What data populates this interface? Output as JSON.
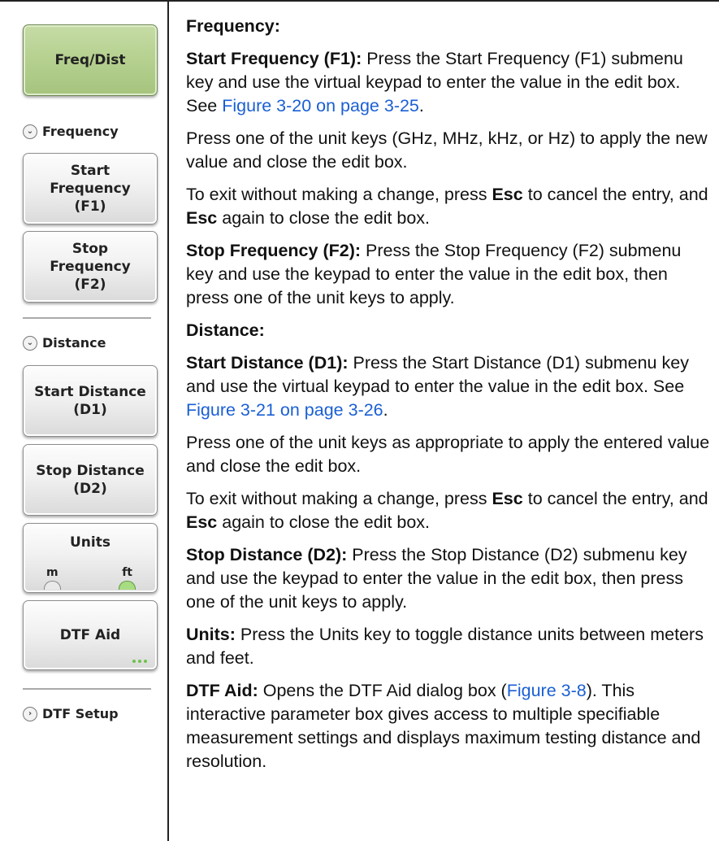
{
  "menu": {
    "freq_dist": "Freq/Dist",
    "frequency_header": "Frequency",
    "start_frequency": "Start\nFrequency\n(F1)",
    "stop_frequency": "Stop\nFrequency\n(F2)",
    "distance_header": "Distance",
    "start_distance": "Start Distance\n(D1)",
    "stop_distance": "Stop Distance\n(D2)",
    "units": {
      "label": "Units",
      "option_m": "m",
      "option_ft": "ft",
      "selected": "ft"
    },
    "dtf_aid": "DTF Aid",
    "dtf_setup_header": "DTF Setup"
  },
  "content": {
    "frequency_heading": "Frequency:",
    "start_freq_term": "Start Frequency (F1):",
    "start_freq_text": "Press the Start Frequency (F1) submenu key and use the virtual keypad to enter the value in the edit box. See",
    "start_freq_link": "Figure 3-20 on page 3-25",
    "unit_keys_text": "Press one of the unit keys (GHz, MHz, kHz, or Hz) to apply the new value and close the edit box.",
    "exit_1_a": "To exit without making a change, press",
    "esc": "Esc",
    "exit_1_b": "to cancel the entry, and",
    "exit_1_c": "again to close the edit box.",
    "stop_freq_term": "Stop Frequency (F2):",
    "stop_freq_text": "Press the Stop Frequency (F2) submenu key and use the keypad to enter the value in the edit box, then press one of the unit keys to apply.",
    "distance_heading": "Distance:",
    "start_dist_term": "Start Distance (D1):",
    "start_dist_text": "Press the Start Distance (D1) submenu key and use the virtual keypad to enter the value in the edit box. See",
    "start_dist_link": "Figure 3-21 on page 3-26",
    "unit_keys_dist_text": "Press one of the unit keys as appropriate to apply the entered value and close the edit box.",
    "exit_2_a": "To exit without making a change, press",
    "exit_2_b": "to cancel the entry, and",
    "exit_2_c": "again to close the edit box.",
    "stop_dist_term": "Stop Distance (D2):",
    "stop_dist_text": "Press the Stop Distance (D2) submenu key and use the keypad to enter the value in the edit box, then press one of the unit keys to apply.",
    "units_term": "Units:",
    "units_text": "Press the Units key to toggle distance units between meters and feet.",
    "dtf_aid_term": "DTF Aid:",
    "dtf_aid_text_a": "Opens the DTF Aid dialog box (",
    "dtf_aid_link": "Figure 3-8",
    "dtf_aid_text_b": "). This interactive parameter box gives access to multiple specifiable measurement settings and displays maximum testing distance and resolution."
  },
  "colors": {
    "link": "#1a5fd4",
    "active_key": "#b5d08f",
    "led_on": "#a8dc82"
  }
}
